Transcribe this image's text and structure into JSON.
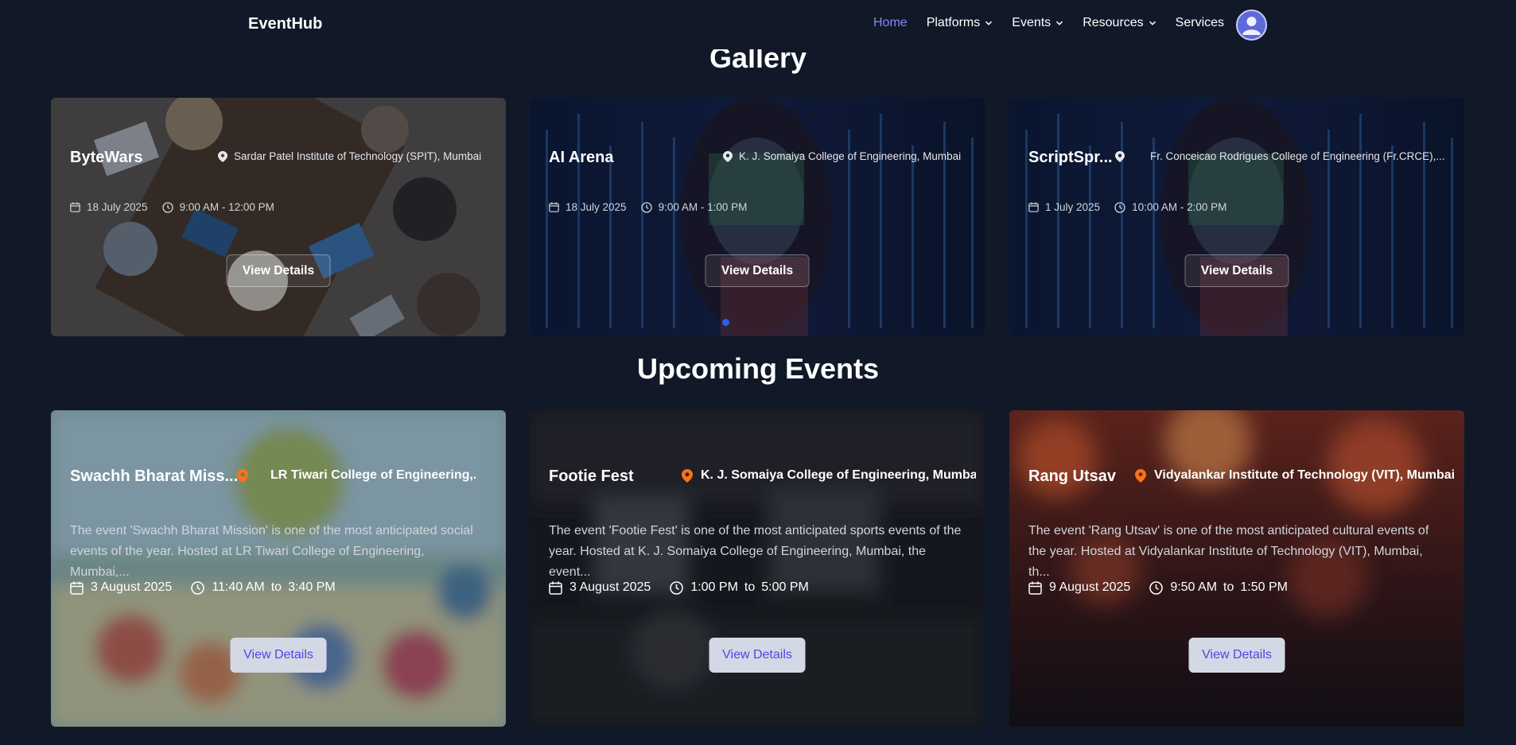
{
  "nav": {
    "brand": "EventHub",
    "links": [
      {
        "label": "Home",
        "active": true,
        "dropdown": false
      },
      {
        "label": "Platforms",
        "active": false,
        "dropdown": true
      },
      {
        "label": "Events",
        "active": false,
        "dropdown": true
      },
      {
        "label": "Resources",
        "active": false,
        "dropdown": true
      },
      {
        "label": "Services",
        "active": false,
        "dropdown": false
      }
    ],
    "avatar_icon": "user-avatar-icon"
  },
  "gallery": {
    "title": "Gallery",
    "cards": [
      {
        "title": "ByteWars",
        "location": "Sardar Patel Institute of Technology (SPIT), Mumbai",
        "date": "18 July 2025",
        "time": "9:00 AM - 12:00 PM",
        "button": "View Details"
      },
      {
        "title": "AI Arena",
        "location": "K. J. Somaiya College of Engineering, Mumbai",
        "date": "18 July 2025",
        "time": "9:00 AM - 1:00 PM",
        "button": "View Details"
      },
      {
        "title": "ScriptSpr...",
        "location": "Fr. Conceicao Rodrigues College of Engineering (Fr.CRCE),...",
        "date": "1 July 2025",
        "time": "10:00 AM - 2:00 PM",
        "button": "View Details"
      }
    ]
  },
  "upcoming": {
    "title": "Upcoming Events",
    "cards": [
      {
        "title": "Swachh Bharat Miss...",
        "location": "LR Tiwari College of Engineering,...",
        "description": "The event 'Swachh Bharat Mission' is one of the most anticipated social events of the year. Hosted at LR Tiwari College of Engineering, Mumbai,...",
        "date": "3 August 2025",
        "start": "11:40 AM",
        "to": "to",
        "end": "3:40 PM",
        "button": "View Details"
      },
      {
        "title": "Footie Fest",
        "location": "K. J. Somaiya College of Engineering, Mumbai",
        "description": "The event 'Footie Fest' is one of the most anticipated sports events of the year. Hosted at K. J. Somaiya College of Engineering, Mumbai, the event...",
        "date": "3 August 2025",
        "start": "1:00 PM",
        "to": "to",
        "end": "5:00 PM",
        "button": "View Details"
      },
      {
        "title": "Rang Utsav",
        "location": "Vidyalankar Institute of Technology (VIT), Mumbai",
        "description": "The event 'Rang Utsav' is one of the most anticipated cultural events of the year. Hosted at Vidyalankar Institute of Technology (VIT), Mumbai, th...",
        "date": "9 August 2025",
        "start": "9:50 AM",
        "to": "to",
        "end": "1:50 PM",
        "button": "View Details"
      }
    ]
  },
  "colors": {
    "background": "#111827",
    "nav_active": "#818cf8",
    "pin_orange": "#f97316",
    "carousel_dot": "#2563eb",
    "button_text": "#4f46e5"
  }
}
